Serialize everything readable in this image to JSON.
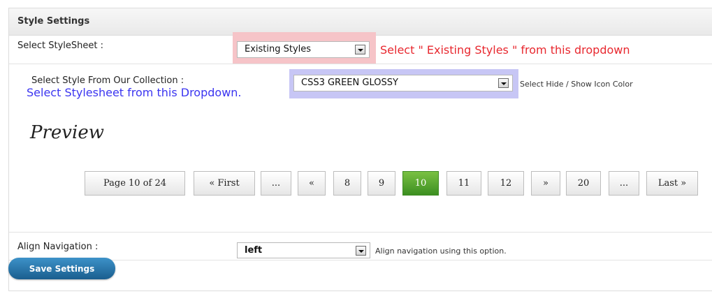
{
  "panel": {
    "title": "Style Settings"
  },
  "stylesheet": {
    "label": "Select StyleSheet :",
    "selected": "Existing Styles",
    "annotation": "Select \" Existing Styles \" from this dropdown"
  },
  "collection": {
    "label": "Select Style From Our Collection :",
    "annotation": "Select Stylesheet from this Dropdown.",
    "selected": "CSS3 GREEN GLOSSY",
    "icon_color_label": "Select Hide / Show Icon Color"
  },
  "preview": {
    "heading": "Preview",
    "pagination": [
      {
        "label": "Page 10 of 24",
        "active": false
      },
      {
        "label": "« First",
        "active": false
      },
      {
        "label": "...",
        "active": false
      },
      {
        "label": "«",
        "active": false
      },
      {
        "label": "8",
        "active": false
      },
      {
        "label": "9",
        "active": false
      },
      {
        "label": "10",
        "active": true
      },
      {
        "label": "11",
        "active": false
      },
      {
        "label": "12",
        "active": false
      },
      {
        "label": "»",
        "active": false
      },
      {
        "label": "20",
        "active": false
      },
      {
        "label": "...",
        "active": false
      },
      {
        "label": "Last »",
        "active": false
      }
    ]
  },
  "align": {
    "label": "Align Navigation :",
    "selected": "left",
    "hint": "Align navigation using this option."
  },
  "save_button": "Save Settings",
  "colors": {
    "active_page": "#4ca12c",
    "save_button": "#226b9c",
    "annotation_red": "#e8282f",
    "annotation_blue": "#3b35f0"
  }
}
